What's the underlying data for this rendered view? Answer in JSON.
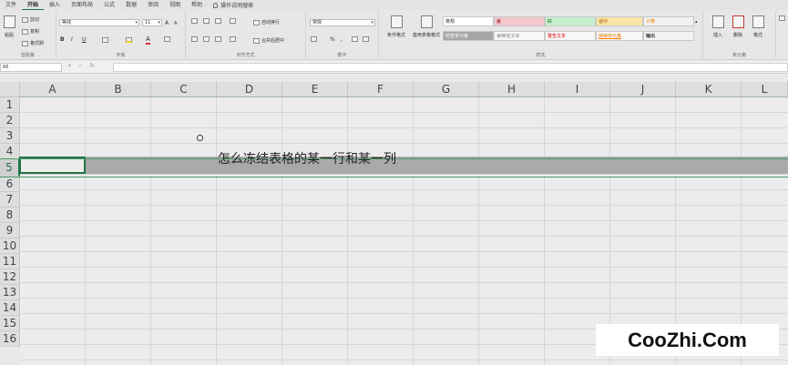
{
  "ribbon_tabs": [
    "文件",
    "开始",
    "插入",
    "页面布局",
    "公式",
    "数据",
    "审阅",
    "视图",
    "帮助"
  ],
  "tell_me": "操作说明搜索",
  "clipboard": {
    "paste": "粘贴",
    "cut": "剪切",
    "copy": "复制",
    "format_painter": "格式刷",
    "label": "剪贴板"
  },
  "font": {
    "name": "等线",
    "size": "11",
    "bold": "B",
    "italic": "I",
    "underline": "U",
    "grow": "A",
    "shrink": "A",
    "color_letter": "A",
    "label": "字体"
  },
  "alignment": {
    "wrap": "自动换行",
    "merge": "合并后居中",
    "label": "对齐方式"
  },
  "number": {
    "format": "常规",
    "percent": "%",
    "comma": ",",
    "label": "数字"
  },
  "styles": {
    "conditional": "条件格式",
    "table": "套用表格格式",
    "cells": [
      {
        "text": "常规"
      },
      {
        "text": "差"
      },
      {
        "text": "好"
      },
      {
        "text": "适中"
      },
      {
        "text": "计算"
      },
      {
        "text": "检查单元格"
      },
      {
        "text": "解释性文本"
      },
      {
        "text": "警告文本"
      },
      {
        "text": "链接单元格"
      },
      {
        "text": "输出"
      }
    ],
    "label": "样式"
  },
  "cells_group": {
    "insert": "插入",
    "delete": "删除",
    "format": "格式",
    "label": "单元格"
  },
  "colors": {
    "accent": "#217346",
    "bad_bg": "#f3c8cd",
    "bad_fg": "#9c0006",
    "good_bg": "#c6efce",
    "good_fg": "#006100",
    "neutral_bg": "#fbe5a6",
    "neutral_fg": "#9c5700",
    "calc_bg": "#f2f2f2",
    "calc_fg": "#fa7d00",
    "check_bg": "#a5a5a5",
    "selection": "#a9a9a9"
  },
  "formula_bar": {
    "name_box": "A5",
    "cancel": "✕",
    "enter": "✓",
    "fx": "fx",
    "content": ""
  },
  "columns": [
    "A",
    "B",
    "C",
    "D",
    "E",
    "F",
    "G",
    "H",
    "I",
    "J",
    "K",
    "L"
  ],
  "rows": [
    "1",
    "2",
    "3",
    "4",
    "5",
    "6",
    "7",
    "8",
    "9",
    "10",
    "11",
    "12",
    "13",
    "14",
    "15",
    "16"
  ],
  "cells": {
    "D4": "怎么冻结表格的某一行和某一列"
  },
  "selected_row": "5",
  "watermark": "CooZhi.Com"
}
